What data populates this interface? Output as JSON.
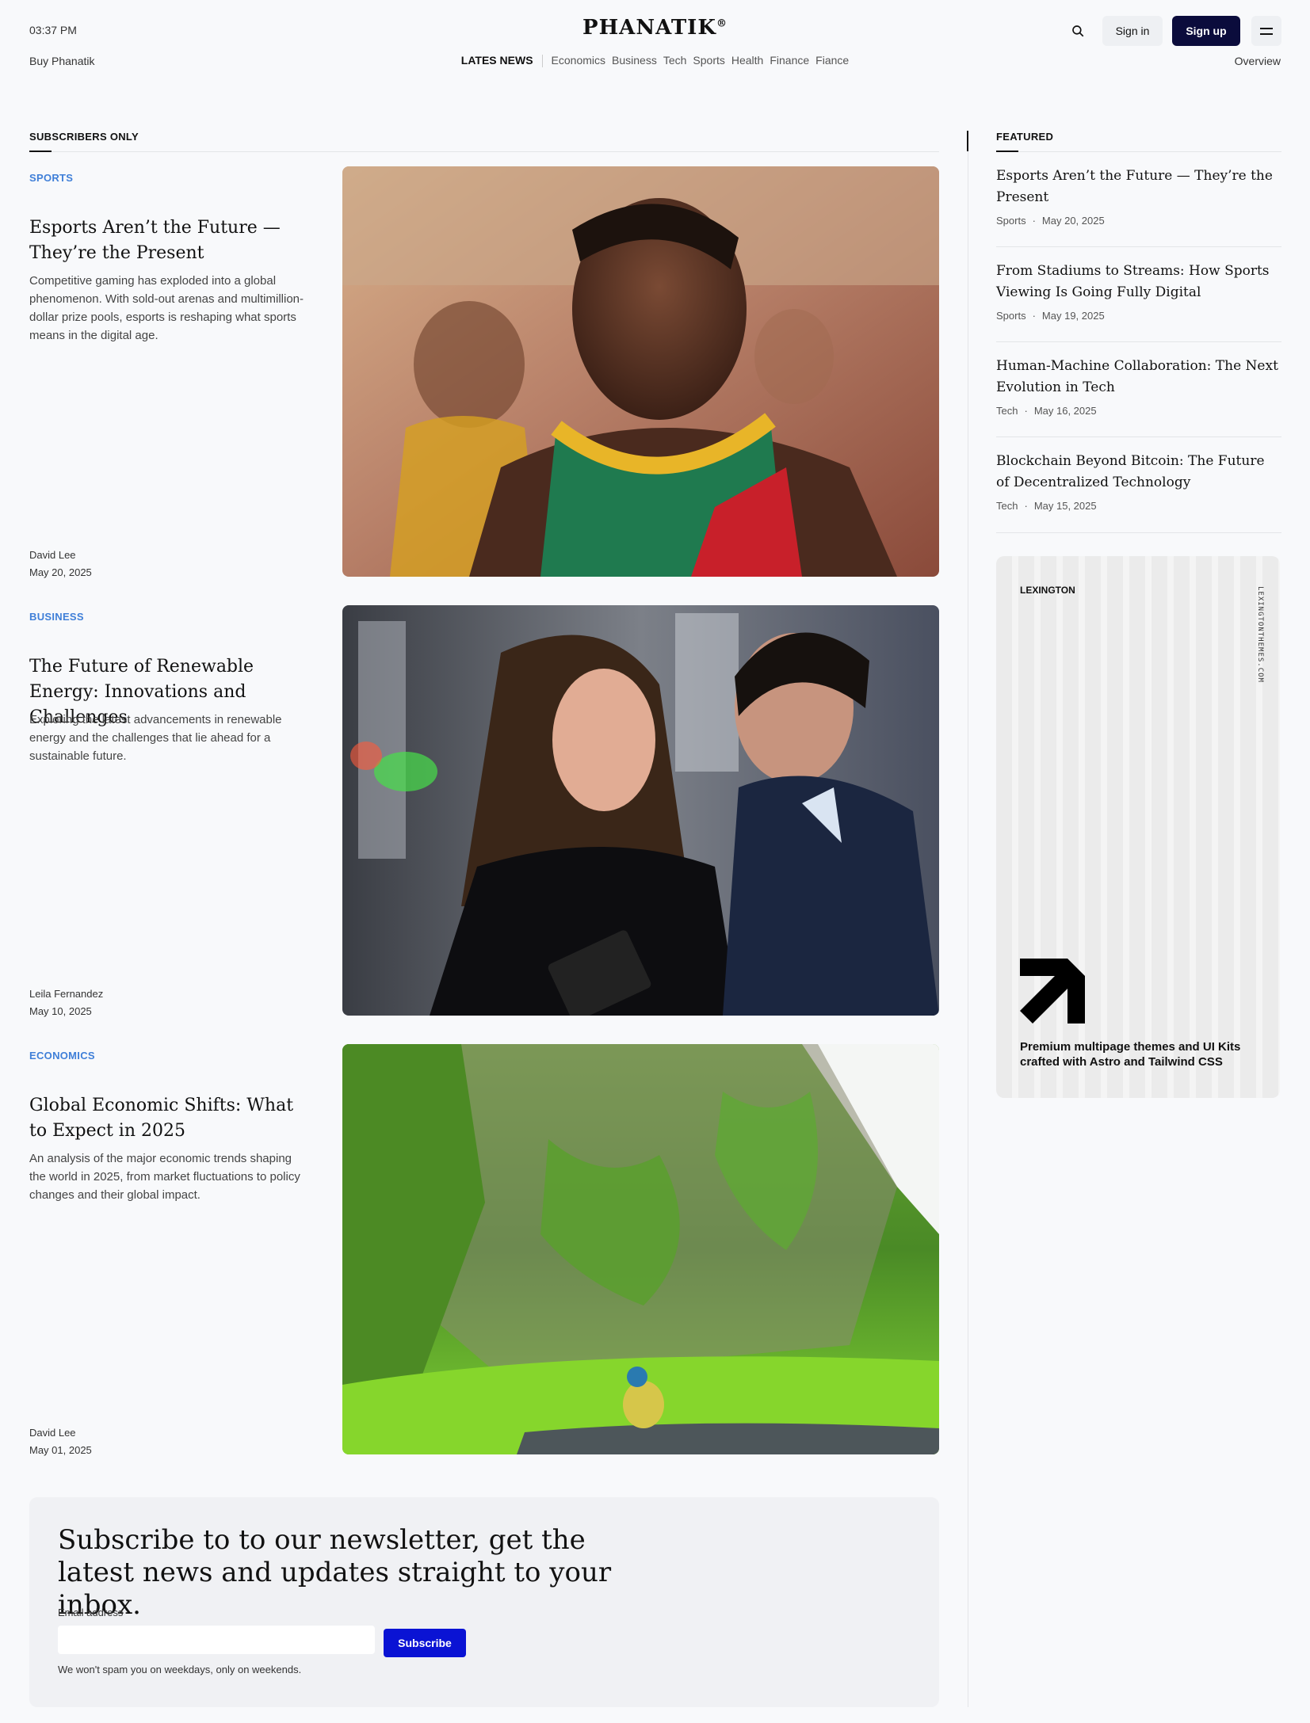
{
  "header": {
    "time": "03:37 PM",
    "buy_link": "Buy Phanatik",
    "logo": "PHANATIK",
    "logo_mark": "®",
    "nav": [
      "LATES NEWS",
      "Economics",
      "Business",
      "Tech",
      "Sports",
      "Health",
      "Finance",
      "Fiance"
    ],
    "sign_in": "Sign in",
    "sign_up": "Sign up",
    "overview": "Overview",
    "icons": [
      "search-icon",
      "menu-icon"
    ]
  },
  "main": {
    "section_title": "SUBSCRIBERS ONLY",
    "articles": [
      {
        "category": "SPORTS",
        "title": "Esports Aren’t the Future — They’re the Present",
        "description": "Competitive gaming has exploded into a global phenomenon. With sold-out arenas and multimillion-dollar prize pools, esports is reshaping what sports means in the digital age.",
        "author": "David Lee",
        "date": "May 20, 2025",
        "image": "runner-photo"
      },
      {
        "category": "BUSINESS",
        "title": "The Future of Renewable Energy: Innovations and Challenges",
        "description": "Exploring the latest advancements in renewable energy and the challenges that lie ahead for a sustainable future.",
        "author": "Leila Fernandez",
        "date": "May 10, 2025",
        "image": "business-people-photo"
      },
      {
        "category": "ECONOMICS",
        "title": "Global Economic Shifts: What to Expect in 2025",
        "description": "An analysis of the major economic trends shaping the world in 2025, from market fluctuations to policy changes and their global impact.",
        "author": "David Lee",
        "date": "May 01, 2025",
        "image": "cliff-cyclist-photo"
      }
    ]
  },
  "sidebar": {
    "section_title": "FEATURED",
    "featured": [
      {
        "title": "Esports Aren’t the Future — They’re the Present",
        "category": "Sports",
        "date": "May 20, 2025"
      },
      {
        "title": "From Stadiums to Streams: How Sports Viewing Is Going Fully Digital",
        "category": "Sports",
        "date": "May 19, 2025"
      },
      {
        "title": "Human-Machine Collaboration: The Next Evolution in Tech",
        "category": "Tech",
        "date": "May 16, 2025"
      },
      {
        "title": "Blockchain Beyond Bitcoin: The Future of Decentralized Technology",
        "category": "Tech",
        "date": "May 15, 2025"
      }
    ],
    "meta_separator": "·",
    "ad": {
      "brand": "LEXINGTON",
      "vertical_text": "LEXINGTONTHEMES.COM",
      "tagline": "Premium multipage themes and UI Kits crafted with Astro and Tailwind CSS"
    }
  },
  "newsletter": {
    "title": "Subscribe to to our newsletter, get the latest news and updates straight to your inbox.",
    "email_label": "Email address",
    "email_value": "",
    "email_placeholder": "",
    "button": "Subscribe",
    "note": "We won't spam you on weekdays, only on weekends."
  },
  "colors": {
    "background": "#f8f9fb",
    "accent_blue": "#3f7fd8",
    "signup_bg": "#0b0c3c",
    "subscribe_bg": "#0a13d4"
  }
}
